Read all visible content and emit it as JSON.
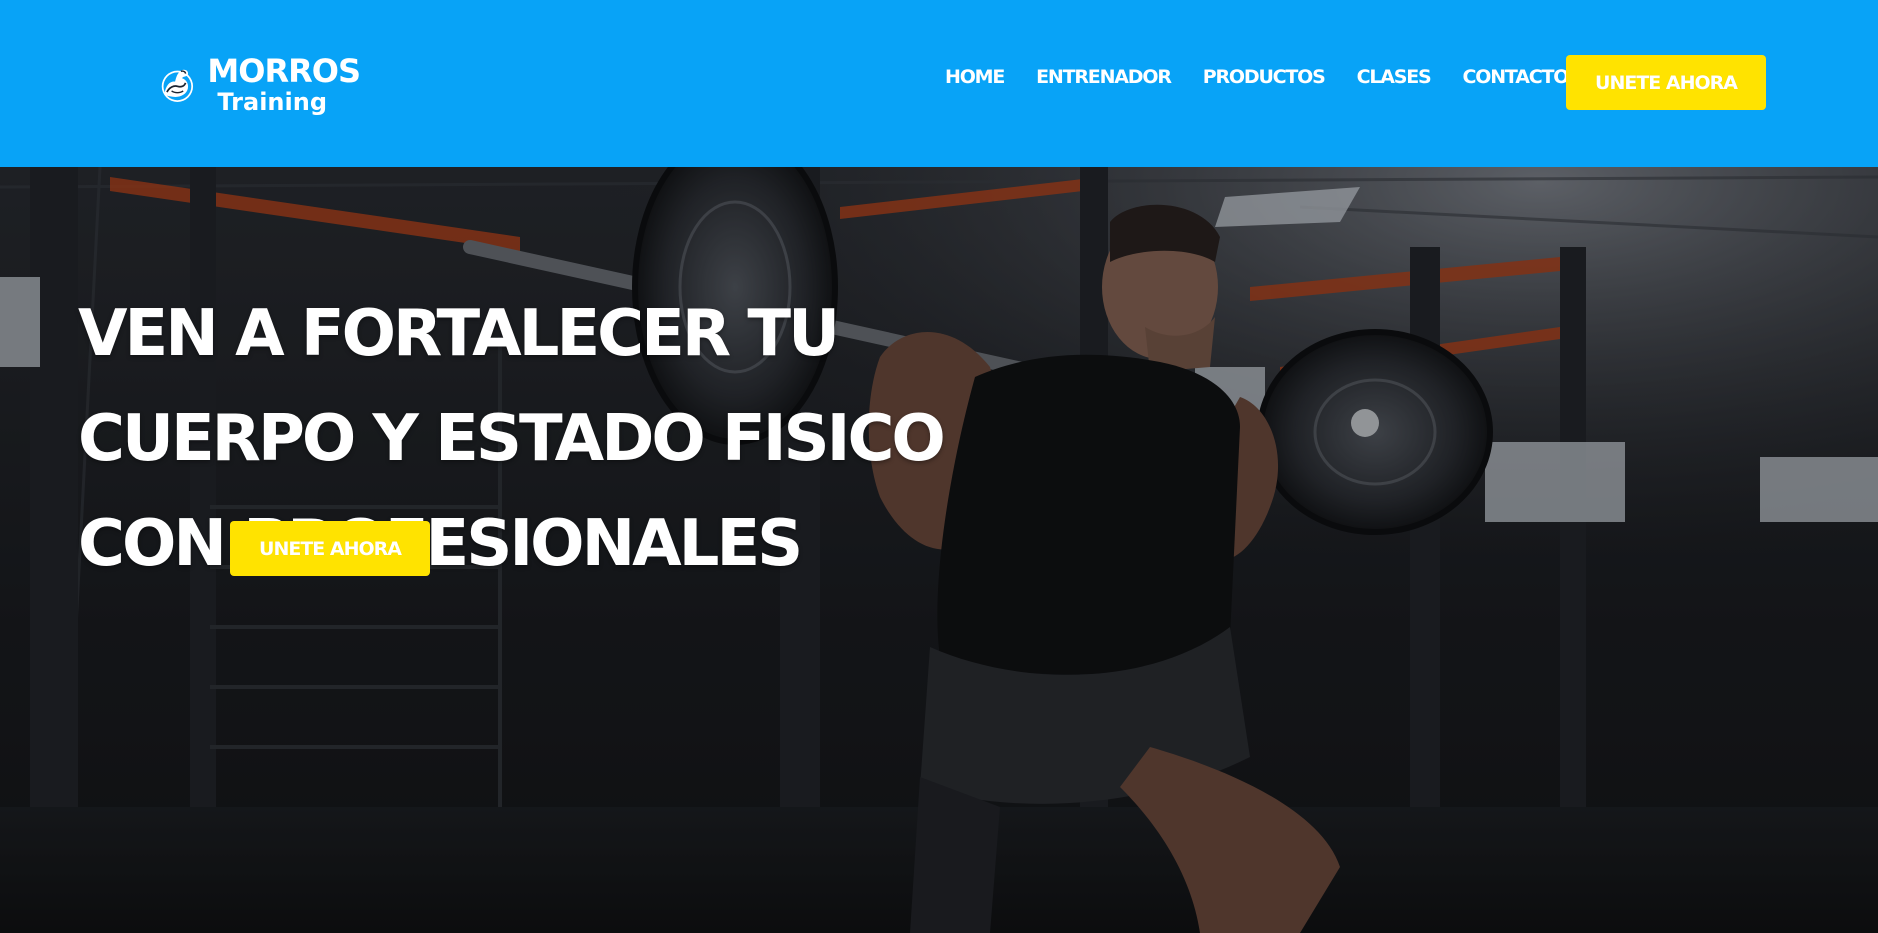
{
  "brand": {
    "name_line1": "MORROS",
    "name_line2": "Training",
    "icon": "flexed-arm-icon"
  },
  "nav": {
    "items": [
      "HOME",
      "ENTRENADOR",
      "PRODUCTOS",
      "CLASES",
      "CONTACTOS"
    ]
  },
  "header": {
    "cta_label": "UNETE AHORA"
  },
  "hero": {
    "title": "VEN A FORTALECER TU CUERPO Y ESTADO FISICO CON PROFESIONALES",
    "cta_label": "UNETE AHORA",
    "background": "gym-weightlifter-squat-photo"
  },
  "colors": {
    "header_bg": "#08a3f7",
    "cta_bg": "#ffe300",
    "text": "#ffffff"
  }
}
